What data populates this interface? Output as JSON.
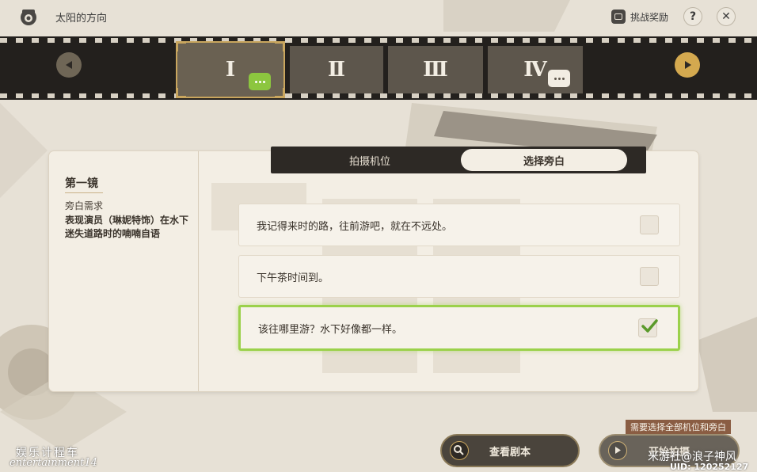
{
  "header": {
    "title": "太阳的方向",
    "reward_label": "挑战奖励",
    "help_icon": "question-icon",
    "close_icon": "close-icon"
  },
  "film_strip": {
    "frames": [
      {
        "label": "Ⅰ",
        "active": true,
        "bubble": "chat-icon",
        "bubble_color": "#8cc63f"
      },
      {
        "label": "Ⅱ",
        "active": false
      },
      {
        "label": "Ⅲ",
        "active": false
      },
      {
        "label": "Ⅳ",
        "active": false,
        "bubble": "chat-add-icon",
        "bubble_color": "#f2ede3"
      }
    ],
    "prev_icon": "arrow-left-icon",
    "next_icon": "arrow-right-icon"
  },
  "left_panel": {
    "shot_title": "第一镜",
    "requirement_label": "旁白需求",
    "requirement_text": "表现演员（琳妮特饰）在水下迷失道路时的喃喃自语"
  },
  "tabs": [
    {
      "label": "拍摄机位",
      "active": false
    },
    {
      "label": "选择旁白",
      "active": true
    }
  ],
  "options": [
    {
      "text": "我记得来时的路，往前游吧，就在不远处。",
      "checked": false
    },
    {
      "text": "下午茶时间到。",
      "checked": false
    },
    {
      "text": "该往哪里游？水下好像都一样。",
      "checked": true
    }
  ],
  "footer": {
    "warning": "需要选择全部机位和旁白",
    "view_script_label": "查看剧本",
    "start_label": "开始拍摄"
  },
  "watermarks": {
    "line1": "娱乐计程车",
    "line2": "entertainment14",
    "line3": "米游社@浪子神风",
    "uid": "UID: 120252127"
  },
  "colors": {
    "accent_green": "#9bd14b",
    "film_dark": "#23201d",
    "gold": "#c9a65e"
  }
}
